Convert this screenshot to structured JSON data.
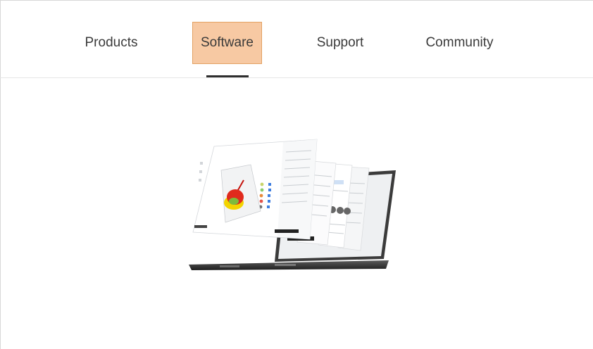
{
  "nav": {
    "items": [
      {
        "label": "Products"
      },
      {
        "label": "Software"
      },
      {
        "label": "Support"
      },
      {
        "label": "Community"
      }
    ],
    "active_index": 1
  },
  "colors": {
    "active_bg": "#f7c9a3",
    "active_border": "#e3a162",
    "underline": "#2e2e2e",
    "text": "#3a3a3a"
  },
  "icons": {
    "hero": "software-on-laptop-illustration"
  }
}
